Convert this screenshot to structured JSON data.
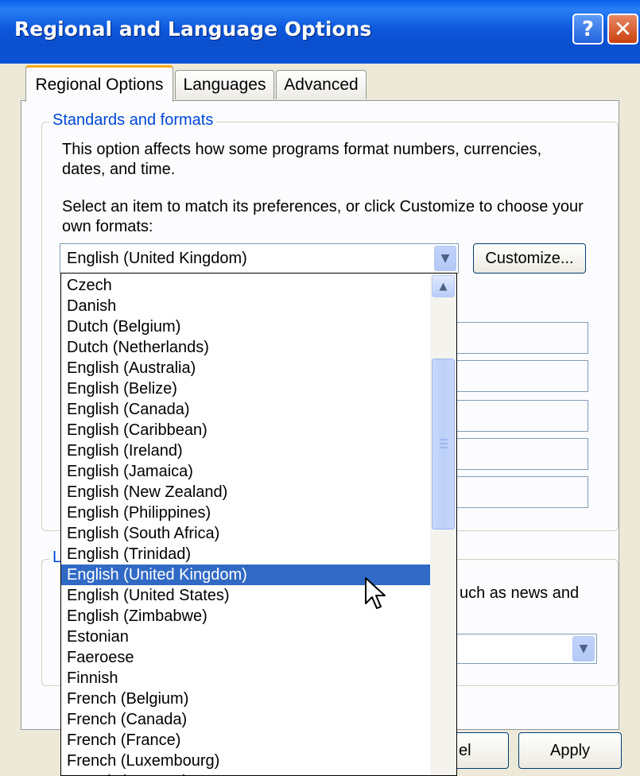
{
  "window": {
    "title": "Regional and Language Options",
    "help_glyph": "?",
    "close_glyph": "✕"
  },
  "tabs": [
    {
      "label": "Regional Options",
      "active": true
    },
    {
      "label": "Languages",
      "active": false
    },
    {
      "label": "Advanced",
      "active": false
    }
  ],
  "standards": {
    "group_label": "Standards and formats",
    "desc1": "This option affects how some programs format numbers, currencies, dates, and time.",
    "desc2": "Select an item to match its preferences, or click Customize to choose your own formats:",
    "selected_value": "English (United Kingdom)",
    "customize_label": "Customize..."
  },
  "location": {
    "group_label_partial": "L",
    "desc_partial": "uch as news and"
  },
  "buttons": {
    "cancel_partial": "el",
    "apply": "Apply"
  },
  "dropdown_list": {
    "items": [
      "Czech",
      "Danish",
      "Dutch (Belgium)",
      "Dutch (Netherlands)",
      "English (Australia)",
      "English (Belize)",
      "English (Canada)",
      "English (Caribbean)",
      "English (Ireland)",
      "English (Jamaica)",
      "English (New Zealand)",
      "English (Philippines)",
      "English (South Africa)",
      "English (Trinidad)",
      "English (United Kingdom)",
      "English (United States)",
      "English (Zimbabwe)",
      "Estonian",
      "Faeroese",
      "Finnish",
      "French (Belgium)",
      "French (Canada)",
      "French (France)",
      "French (Luxembourg)",
      "French (Monaco)"
    ],
    "selected_item": "English (United Kingdom)"
  },
  "colors": {
    "titlebar": "#0a54d6",
    "selection": "#316ac5",
    "group_label": "#0046d5",
    "tab_highlight": "#f6a817"
  }
}
